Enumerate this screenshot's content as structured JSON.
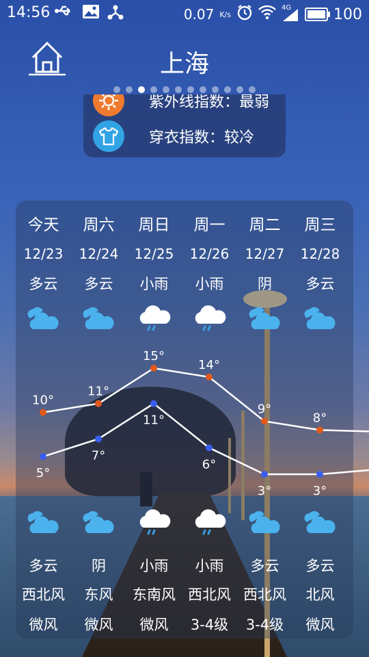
{
  "status_bar": {
    "time": "14:56",
    "icons_left": [
      "usb-icon",
      "image-icon",
      "share-icon"
    ],
    "speed": "0.07",
    "speed_unit": "K/s",
    "network": "4G",
    "battery": "100",
    "battery_level": 100
  },
  "header": {
    "city": "上海",
    "page_count": 12,
    "active_page": 2
  },
  "indices": [
    {
      "icon": "sun-icon",
      "label": "紫外线指数：最弱",
      "color": "#f07a2e"
    },
    {
      "icon": "tshirt-icon",
      "label": "穿衣指数：较冷",
      "color": "#32a4e6"
    }
  ],
  "forecast": {
    "days": [
      {
        "day": "今天",
        "date": "12/23",
        "cond_day": "多云",
        "icon_day": "cloud-icon",
        "high": 10,
        "low": 5,
        "cond_night": "多云",
        "icon_night": "cloud-icon",
        "wind_dir": "西北风",
        "wind_level": "微风"
      },
      {
        "day": "周六",
        "date": "12/24",
        "cond_day": "多云",
        "icon_day": "cloud-icon",
        "high": 11,
        "low": 7,
        "cond_night": "阴",
        "icon_night": "cloud-icon",
        "wind_dir": "东风",
        "wind_level": "微风"
      },
      {
        "day": "周日",
        "date": "12/25",
        "cond_day": "小雨",
        "icon_day": "rain-icon",
        "high": 15,
        "low": 11,
        "cond_night": "小雨",
        "icon_night": "rain-icon",
        "wind_dir": "东南风",
        "wind_level": "微风"
      },
      {
        "day": "周一",
        "date": "12/26",
        "cond_day": "小雨",
        "icon_day": "rain-icon",
        "high": 14,
        "low": 6,
        "cond_night": "小雨",
        "icon_night": "rain-icon",
        "wind_dir": "西北风",
        "wind_level": "3-4级"
      },
      {
        "day": "周二",
        "date": "12/27",
        "cond_day": "阴",
        "icon_day": "cloud-icon",
        "high": 9,
        "low": 3,
        "cond_night": "多云",
        "icon_night": "cloud-icon",
        "wind_dir": "西北风",
        "wind_level": "3-4级"
      },
      {
        "day": "周三",
        "date": "12/28",
        "cond_day": "多云",
        "icon_day": "cloud-icon",
        "high": 8,
        "low": 3,
        "cond_night": "多云",
        "icon_night": "cloud-icon",
        "wind_dir": "北风",
        "wind_level": "微风"
      }
    ],
    "high_text": [
      "10°",
      "11°",
      "15°",
      "14°",
      "9°",
      "8°"
    ],
    "low_text": [
      "5°",
      "7°",
      "11°",
      "6°",
      "3°",
      "3°"
    ],
    "high_color": "#e25a1c",
    "low_color": "#3a5ef0"
  }
}
